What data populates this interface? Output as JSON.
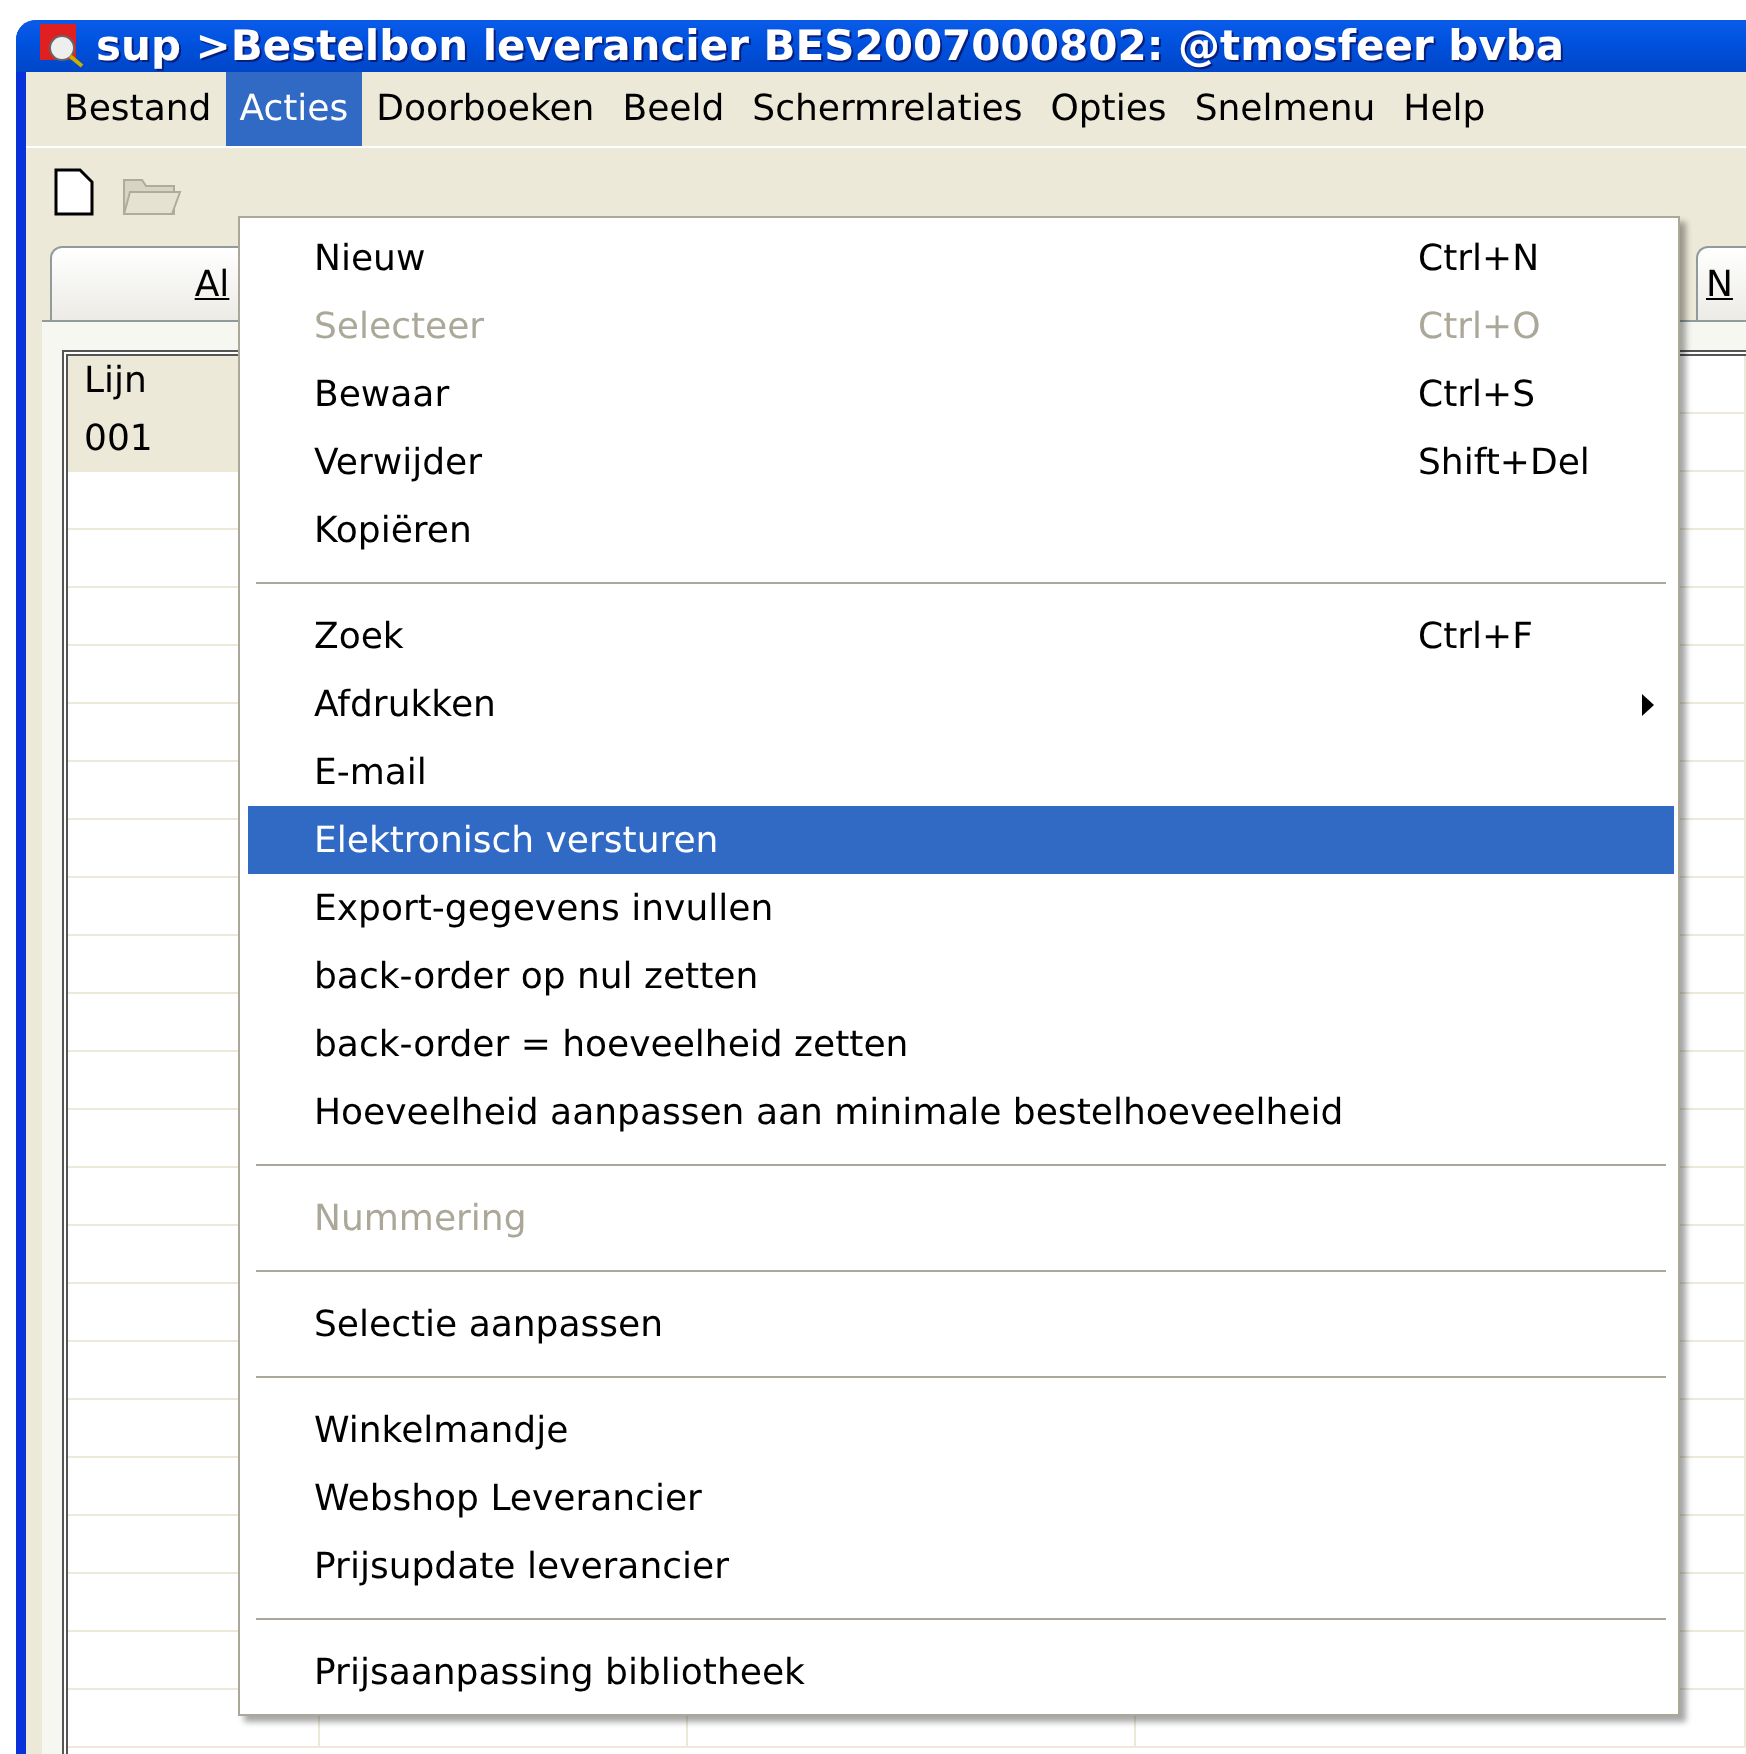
{
  "window": {
    "title": "sup >Bestelbon leverancier BES2007000802: @tmosfeer bvba"
  },
  "menu_bar": [
    {
      "label": "Bestand",
      "selected": false
    },
    {
      "label": "Acties",
      "selected": true
    },
    {
      "label": "Doorboeken",
      "selected": false
    },
    {
      "label": "Beeld",
      "selected": false
    },
    {
      "label": "Schermrelaties",
      "selected": false
    },
    {
      "label": "Opties",
      "selected": false
    },
    {
      "label": "Snelmenu",
      "selected": false
    },
    {
      "label": "Help",
      "selected": false
    }
  ],
  "tabs": [
    {
      "label": "Al",
      "selected": false
    },
    {
      "label": "N",
      "selected": false
    }
  ],
  "grid": {
    "header": "Lijn",
    "rows": [
      "001"
    ]
  },
  "menu": [
    {
      "kind": "item",
      "label": "Nieuw",
      "shortcut": "Ctrl+N",
      "disabled": false,
      "selected": false
    },
    {
      "kind": "item",
      "label": "Selecteer",
      "shortcut": "Ctrl+O",
      "disabled": true,
      "selected": false
    },
    {
      "kind": "item",
      "label": "Bewaar",
      "shortcut": "Ctrl+S",
      "disabled": false,
      "selected": false
    },
    {
      "kind": "item",
      "label": "Verwijder",
      "shortcut": "Shift+Del",
      "disabled": false,
      "selected": false
    },
    {
      "kind": "item",
      "label": "Kopiëren",
      "disabled": false,
      "selected": false
    },
    {
      "kind": "separator"
    },
    {
      "kind": "item",
      "label": "Zoek",
      "shortcut": "Ctrl+F",
      "disabled": false,
      "selected": false
    },
    {
      "kind": "submenu",
      "label": "Afdrukken",
      "disabled": false,
      "selected": false
    },
    {
      "kind": "item",
      "label": "E-mail",
      "disabled": false,
      "selected": false
    },
    {
      "kind": "item",
      "label": "Elektronisch versturen",
      "disabled": false,
      "selected": true
    },
    {
      "kind": "item",
      "label": "Export-gegevens invullen",
      "disabled": false,
      "selected": false
    },
    {
      "kind": "item",
      "label": "back-order op nul zetten",
      "disabled": false,
      "selected": false
    },
    {
      "kind": "item",
      "label": "back-order = hoeveelheid zetten",
      "disabled": false,
      "selected": false
    },
    {
      "kind": "item",
      "label": "Hoeveelheid aanpassen aan minimale bestelhoeveelheid",
      "disabled": false,
      "selected": false
    },
    {
      "kind": "separator"
    },
    {
      "kind": "item",
      "label": "Nummering",
      "disabled": true,
      "selected": false
    },
    {
      "kind": "separator"
    },
    {
      "kind": "item",
      "label": "Selectie aanpassen",
      "disabled": false,
      "selected": false
    },
    {
      "kind": "separator"
    },
    {
      "kind": "item",
      "label": "Winkelmandje",
      "disabled": false,
      "selected": false
    },
    {
      "kind": "item",
      "label": "Webshop Leverancier",
      "disabled": false,
      "selected": false
    },
    {
      "kind": "item",
      "label": "Prijsupdate leverancier",
      "disabled": false,
      "selected": false
    },
    {
      "kind": "separator"
    },
    {
      "kind": "item",
      "label": "Prijsaanpassing bibliotheek",
      "disabled": false,
      "selected": false
    }
  ]
}
